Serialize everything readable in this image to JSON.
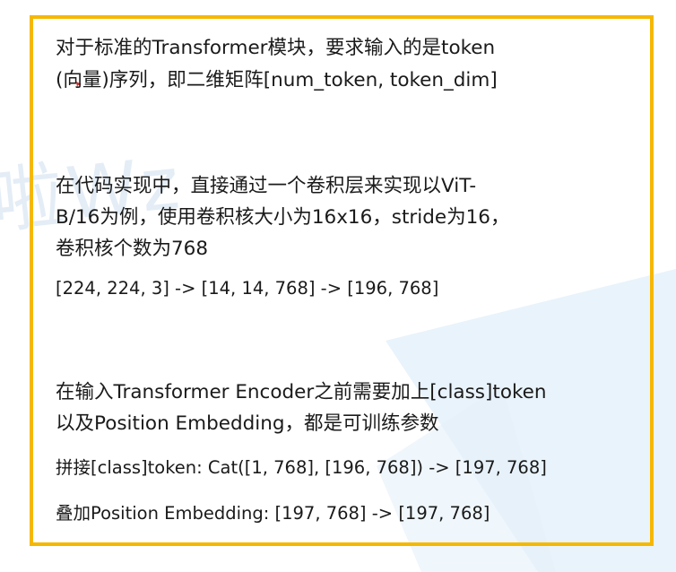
{
  "watermark": {
    "text": "啦Wz"
  },
  "colors": {
    "frame_border": "#f5b800",
    "text": "#1a1a1a",
    "watermark": "#dbe8f4",
    "watermark_shape": "#d7e9f7"
  },
  "paragraphs": {
    "intro_line1": "对于标准的Transformer模块，要求输入的是token",
    "intro_line2": "(向量)序列，即二维矩阵[num_token, token_dim]",
    "vit_line1": "在代码实现中，直接通过一个卷积层来实现以ViT-",
    "vit_line2": "B/16为例，使用卷积核大小为16x16，stride为16，",
    "vit_line3": "卷积核个数为768",
    "shape_flow": "[224, 224, 3] -> [14, 14, 768] -> [196, 768]",
    "encoder_line1": "在输入Transformer Encoder之前需要加上[class]token",
    "encoder_line2": "以及Position Embedding，都是可训练参数",
    "concat_line": "拼接[class]token:   Cat([1, 768], [196, 768]) -> [197, 768]",
    "add_line": "叠加Position Embedding:   [197, 768] -> [197, 768]"
  }
}
